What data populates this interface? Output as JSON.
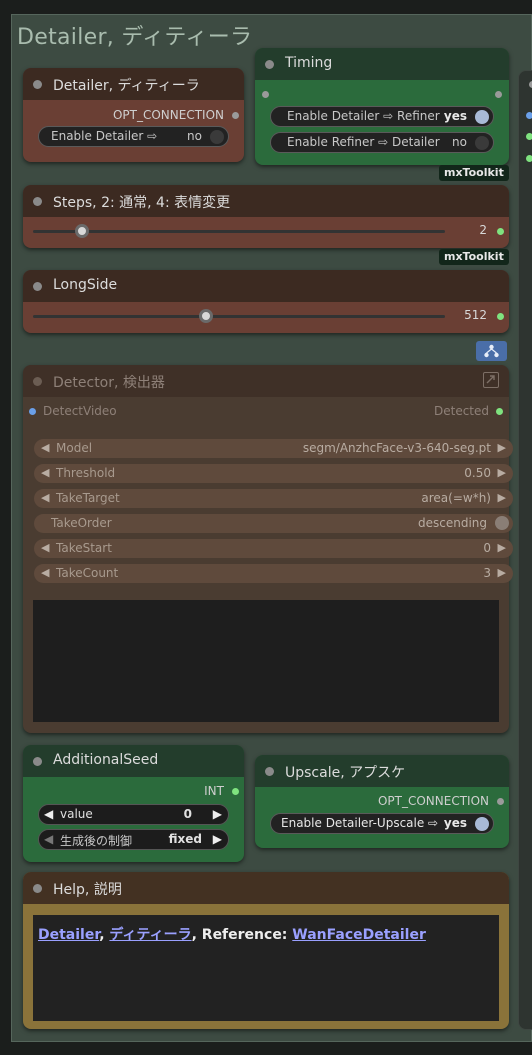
{
  "group": {
    "title": "Detailer, ディティーラ"
  },
  "detailer_node": {
    "title": "Detailer, ディティーラ",
    "output": "OPT_CONNECTION",
    "toggle": {
      "label": "Enable Detailer ⇨",
      "value": "no"
    }
  },
  "timing_node": {
    "title": "Timing",
    "toggles": [
      {
        "label": "Enable Detailer ⇨ Refiner",
        "value": "yes"
      },
      {
        "label": "Enable Refiner ⇨ Detailer",
        "value": "no"
      }
    ],
    "badge": "mxToolkit"
  },
  "steps_node": {
    "title": "Steps, 2: 通常, 4: 表情変更",
    "value": "2",
    "level": 0.12,
    "badge": "mxToolkit"
  },
  "longside_node": {
    "title": "LongSide",
    "value": "512",
    "level": 0.42
  },
  "detector_node": {
    "title": "Detector, 検出器",
    "input": "DetectVideo",
    "output": "Detected",
    "widgets": [
      {
        "label": "Model",
        "value": "segm/AnzhcFace-v3-640-seg.pt"
      },
      {
        "label": "Threshold",
        "value": "0.50"
      },
      {
        "label": "TakeTarget",
        "value": "area(=w*h)"
      },
      {
        "label": "TakeOrder",
        "value": "descending"
      },
      {
        "label": "TakeStart",
        "value": "0"
      },
      {
        "label": "TakeCount",
        "value": "3"
      }
    ]
  },
  "seed_node": {
    "title": "AdditionalSeed",
    "output": "INT",
    "value_label": "value",
    "value": "0",
    "control_label": "生成後の制御",
    "control_value": "fixed"
  },
  "upscale_node": {
    "title": "Upscale, アプスケ",
    "output": "OPT_CONNECTION",
    "toggle": {
      "label": "Enable Detailer-Upscale ⇨",
      "value": "yes"
    }
  },
  "help_node": {
    "title": "Help, 説明",
    "link1": "Detailer",
    "sep1": ",",
    "link2": "ディティーラ",
    "text": ", Reference:",
    "link3": "WanFaceDetailer"
  },
  "colors": {
    "accent": "#7fe37f",
    "toggle_on": "#a8b9d6",
    "link": "#9aa0ff"
  }
}
